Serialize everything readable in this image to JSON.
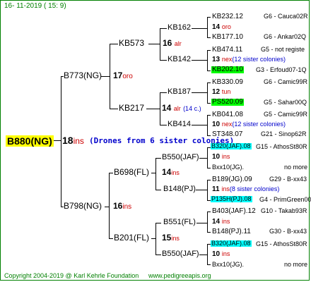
{
  "header": {
    "date": "16-  11-2019  (  15:   9)"
  },
  "footer": {
    "copyright": "Copyright 2004-2019 @ Karl Kehrle Foundation",
    "site": "www.pedigreeapis.org"
  },
  "colors": {
    "link_green": "#008000",
    "accent_red": "#cc0000",
    "drone_blue": "#0000cc",
    "hl_yellow": "#ffff00",
    "hl_green": "#00ff00",
    "hl_cyan": "#00ffff"
  },
  "root": {
    "label": "B880(NG)",
    "gen": "18",
    "suffix": "ins",
    "note": "(Drones from 6 sister colonies)"
  },
  "l1": [
    {
      "label": "B773(NG)",
      "gen": "17",
      "suffix": "oro"
    },
    {
      "label": "B798(NG)",
      "gen": "16",
      "suffix": "ins"
    }
  ],
  "l2": [
    {
      "label": "KB573",
      "gen": "16",
      "suffix": "alr"
    },
    {
      "label": "KB217",
      "gen": "14",
      "suffix": "alr",
      "extra": "(14 c.)"
    },
    {
      "label": "B698(FL)",
      "gen": "14",
      "suffix": "ins"
    },
    {
      "label": "B201(FL)",
      "gen": "15",
      "suffix": "ins"
    }
  ],
  "l3": [
    {
      "label": "KB162"
    },
    {
      "label": "KB142"
    },
    {
      "label": "KB187"
    },
    {
      "label": "KB414"
    },
    {
      "label": "B550(JAF)"
    },
    {
      "label": "B148(PJ)"
    },
    {
      "label": "B551(FL)"
    },
    {
      "label": "B550(JAF)"
    }
  ],
  "l4": [
    {
      "id": "KB232.12",
      "info": "G6 - Cauca02R"
    },
    {
      "gen": "14",
      "suffix": "oro"
    },
    {
      "id": "KB177.10",
      "info": "G6 - Ankar02Q"
    },
    {
      "id": "KB474.11",
      "info": "G5 - not registe"
    },
    {
      "gen": "13",
      "suffix": "nex",
      "note": "(12 sister colonies)"
    },
    {
      "id": "KB202.10",
      "info": "G3 - Erfoud07-1Q"
    },
    {
      "id": "KB330.09",
      "info": "G6 - Camic99R"
    },
    {
      "gen": "12",
      "suffix": "tun"
    },
    {
      "id": "PS520.09",
      "info": "G5 - Sahar00Q"
    },
    {
      "id": "KB041.08",
      "info": "G5 - Camic99R"
    },
    {
      "gen": "10",
      "suffix": "nex",
      "note": "(12 sister colonies)"
    },
    {
      "id": "ST348.07",
      "info": "G21 - Sinop62R"
    },
    {
      "id": "B320(JAF).08",
      "info": "G15 - AthosSt80R"
    },
    {
      "gen": "10",
      "suffix": "ins"
    },
    {
      "id": "Bxx10(JG).",
      "info": "no more"
    },
    {
      "id": "B189(JG).09",
      "info": "G29 - B-xx43"
    },
    {
      "gen": "11",
      "suffix": "ins",
      "note": "(8 sister colonies)"
    },
    {
      "id": "P135H(PJ).08",
      "info": "G4 - PrimGreen00"
    },
    {
      "id": "B403(JAF).12",
      "info": "G10 - Takab93R"
    },
    {
      "gen": "14",
      "suffix": "ins"
    },
    {
      "id": "B148(PJ).11",
      "info": "G30 - B-xx43"
    },
    {
      "id": "B320(JAF).08",
      "info": "G15 - AthosSt80R"
    },
    {
      "gen": "10",
      "suffix": "ins"
    },
    {
      "id": "Bxx10(JG).",
      "info": "no more"
    }
  ]
}
